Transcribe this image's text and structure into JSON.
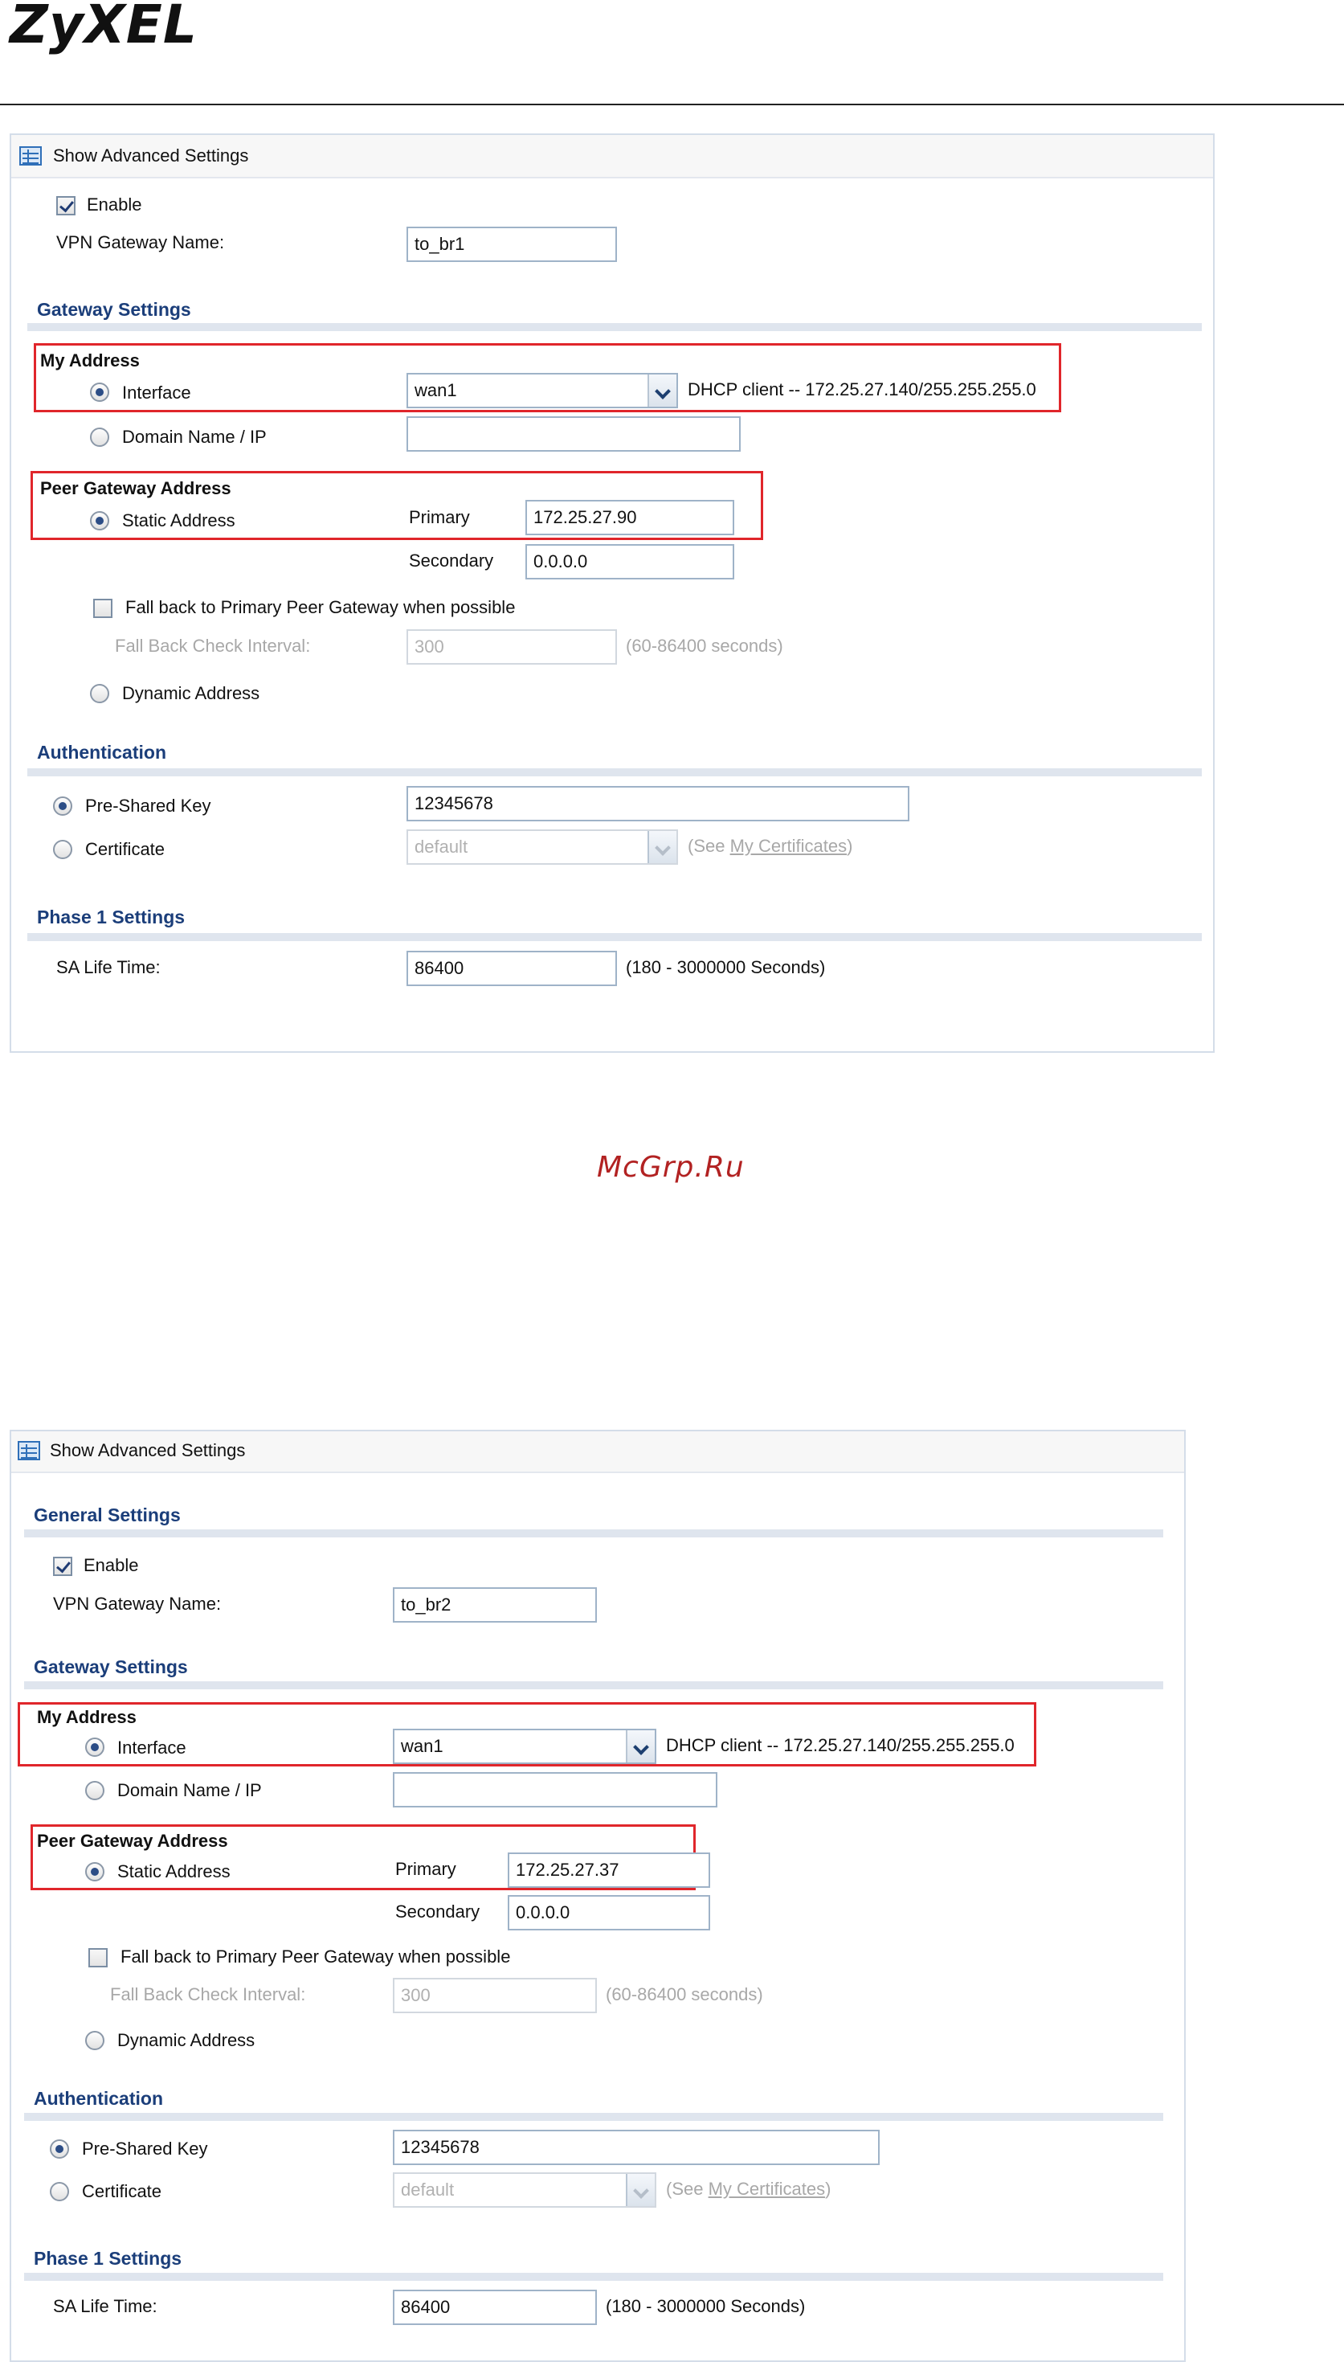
{
  "brand": {
    "logo_text": "ZyXEL"
  },
  "watermark": "McGrp.Ru",
  "colors": {
    "highlight": "#e0262b",
    "section_title": "#1b3e7a",
    "border": "#9fb3c8"
  },
  "panel1": {
    "header": {
      "icon": "table-icon",
      "label": "Show Advanced Settings"
    },
    "enable_label": "Enable",
    "vpn_gateway_name_label": "VPN Gateway Name:",
    "vpn_gateway_name_value": "to_br1",
    "gateway_settings_title": "Gateway Settings",
    "my_address_title": "My Address",
    "interface_label": "Interface",
    "interface_value": "wan1",
    "interface_info": "DHCP client -- 172.25.27.140/255.255.255.0",
    "domain_label": "Domain Name / IP",
    "domain_value": "",
    "peer_title": "Peer Gateway Address",
    "static_label": "Static Address",
    "primary_label": "Primary",
    "primary_value": "172.25.27.90",
    "secondary_label": "Secondary",
    "secondary_value": "0.0.0.0",
    "fallback_label": "Fall back to Primary Peer Gateway when possible",
    "fallback_interval_label": "Fall Back Check Interval:",
    "fallback_interval_value": "300",
    "fallback_interval_hint": "(60-86400 seconds)",
    "dynamic_label": "Dynamic Address",
    "authentication_title": "Authentication",
    "psk_label": "Pre-Shared Key",
    "psk_value": "12345678",
    "cert_label": "Certificate",
    "cert_value": "default",
    "cert_hint_pre": "(See ",
    "cert_hint_link": "My Certificates",
    "cert_hint_post": ")",
    "phase1_title": "Phase 1 Settings",
    "sa_label": "SA Life Time:",
    "sa_value": "86400",
    "sa_hint": "(180 - 3000000 Seconds)"
  },
  "panel2": {
    "header": {
      "icon": "table-icon",
      "label": "Show Advanced Settings"
    },
    "general_title": "General Settings",
    "enable_label": "Enable",
    "vpn_gateway_name_label": "VPN Gateway Name:",
    "vpn_gateway_name_value": "to_br2",
    "gateway_settings_title": "Gateway Settings",
    "my_address_title": "My Address",
    "interface_label": "Interface",
    "interface_value": "wan1",
    "interface_info": "DHCP client -- 172.25.27.140/255.255.255.0",
    "domain_label": "Domain Name / IP",
    "domain_value": "",
    "peer_title": "Peer Gateway Address",
    "static_label": "Static Address",
    "primary_label": "Primary",
    "primary_value": "172.25.27.37",
    "secondary_label": "Secondary",
    "secondary_value": "0.0.0.0",
    "fallback_label": "Fall back to Primary Peer Gateway when possible",
    "fallback_interval_label": "Fall Back Check Interval:",
    "fallback_interval_value": "300",
    "fallback_interval_hint": "(60-86400 seconds)",
    "dynamic_label": "Dynamic Address",
    "authentication_title": "Authentication",
    "psk_label": "Pre-Shared Key",
    "psk_value": "12345678",
    "cert_label": "Certificate",
    "cert_value": "default",
    "cert_hint_pre": "(See ",
    "cert_hint_link": "My Certificates",
    "cert_hint_post": ")",
    "phase1_title": "Phase 1 Settings",
    "sa_label": "SA Life Time:",
    "sa_value": "86400",
    "sa_hint": "(180 - 3000000 Seconds)"
  }
}
